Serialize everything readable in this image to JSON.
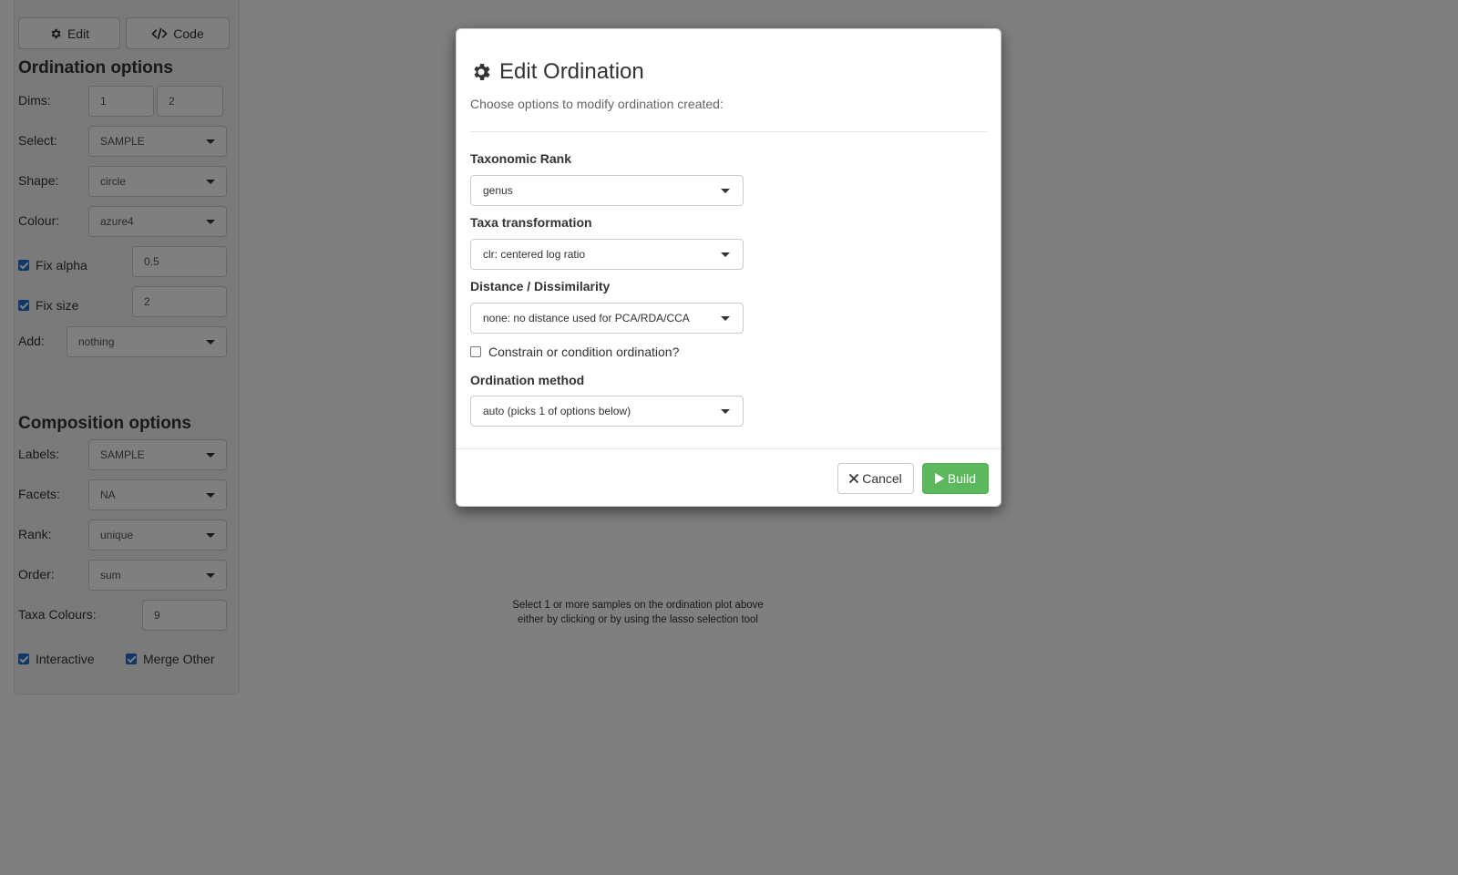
{
  "sidebar": {
    "edit_button": "Edit",
    "code_button": "Code",
    "ordination_title": "Ordination options",
    "dims": {
      "label": "Dims:",
      "values": [
        "1",
        "2"
      ]
    },
    "select": {
      "label": "Select:",
      "value": "SAMPLE"
    },
    "shape": {
      "label": "Shape:",
      "value": "circle"
    },
    "colour": {
      "label": "Colour:",
      "value": "azure4"
    },
    "fix_alpha": {
      "label": "Fix alpha",
      "checked": true,
      "value": "0.5"
    },
    "fix_size": {
      "label": "Fix size",
      "checked": true,
      "value": "2"
    },
    "add": {
      "label": "Add:",
      "value": "nothing"
    },
    "composition_title": "Composition options",
    "labels": {
      "label": "Labels:",
      "value": "SAMPLE"
    },
    "facets": {
      "label": "Facets:",
      "value": "NA"
    },
    "rank": {
      "label": "Rank:",
      "value": "unique"
    },
    "order": {
      "label": "Order:",
      "value": "sum"
    },
    "taxa_colours": {
      "label": "Taxa Colours:",
      "value": "9"
    },
    "interactive": {
      "label": "Interactive",
      "checked": true
    },
    "merge_other": {
      "label": "Merge Other",
      "checked": true
    }
  },
  "main": {
    "hint_line1": "Select 1 or more samples on the ordination plot above",
    "hint_line2": "either by clicking or by using the lasso selection tool"
  },
  "modal": {
    "title": "Edit Ordination",
    "subtitle": "Choose options to modify ordination created:",
    "taxonomic_rank": {
      "label": "Taxonomic Rank",
      "value": "genus"
    },
    "taxa_transformation": {
      "label": "Taxa transformation",
      "value": "clr: centered log ratio"
    },
    "distance": {
      "label": "Distance / Dissimilarity",
      "value": "none: no distance used for PCA/RDA/CCA"
    },
    "constrain": {
      "label": "Constrain or condition ordination?",
      "checked": false
    },
    "ordination_method": {
      "label": "Ordination method",
      "value": "auto (picks 1 of options below)"
    },
    "cancel_label": "Cancel",
    "build_label": "Build"
  },
  "colors": {
    "build_green": "#5cb85c",
    "checkbox_blue": "#1f6fd1",
    "backdrop": "rgba(0,0,0,0.5)"
  },
  "icons": [
    "gear-icon",
    "code-icon",
    "chevron-down-icon",
    "close-icon",
    "play-icon"
  ]
}
